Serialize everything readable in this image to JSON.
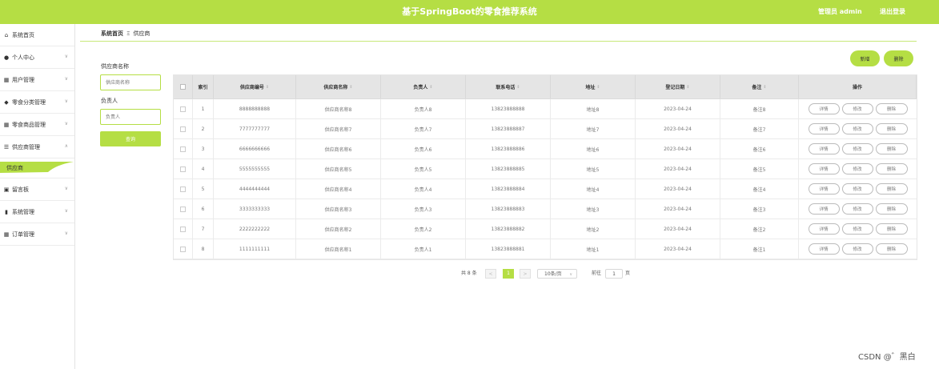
{
  "header": {
    "title": "基于SpringBoot的零食推荐系统",
    "admin": "管理员 admin",
    "logout": "退出登录"
  },
  "sidebar": {
    "items": [
      {
        "label": "系统首页",
        "icon": "home-icon",
        "glyph": "⌂"
      },
      {
        "label": "个人中心",
        "icon": "user-icon",
        "glyph": "●"
      },
      {
        "label": "用户管理",
        "icon": "grid-icon",
        "glyph": "▦"
      },
      {
        "label": "零食分类管理",
        "icon": "tag-icon",
        "glyph": "◆"
      },
      {
        "label": "零食商品管理",
        "icon": "grid-icon",
        "glyph": "▦"
      },
      {
        "label": "供应商管理",
        "icon": "list-icon",
        "glyph": "☰"
      },
      {
        "label": "留言板",
        "icon": "message-icon",
        "glyph": "▣"
      },
      {
        "label": "系统管理",
        "icon": "chart-icon",
        "glyph": "▮"
      },
      {
        "label": "订单管理",
        "icon": "grid-icon",
        "glyph": "▦"
      }
    ],
    "sub_item": "供应商",
    "accent": "#b5de44"
  },
  "breadcrumb": {
    "home": "系统首页",
    "separator": "Ξ",
    "current": "供应商"
  },
  "search": {
    "name_label": "供应商名称",
    "name_placeholder": "供应商名称",
    "person_label": "负责人",
    "person_placeholder": "负责人",
    "query_button": "查询"
  },
  "toolbar": {
    "add": "新增",
    "delete": "删除"
  },
  "table": {
    "headers": [
      "索引",
      "供应商编号",
      "供应商名称",
      "负责人",
      "联系电话",
      "地址",
      "登记日期",
      "备注",
      "操作"
    ],
    "rows": [
      {
        "index": "1",
        "code": "8888888888",
        "name": "供应商名称8",
        "person": "负责人8",
        "phone": "13823888888",
        "address": "地址8",
        "date": "2023-04-24",
        "note": "备注8"
      },
      {
        "index": "2",
        "code": "7777777777",
        "name": "供应商名称7",
        "person": "负责人7",
        "phone": "13823888887",
        "address": "地址7",
        "date": "2023-04-24",
        "note": "备注7"
      },
      {
        "index": "3",
        "code": "6666666666",
        "name": "供应商名称6",
        "person": "负责人6",
        "phone": "13823888886",
        "address": "地址6",
        "date": "2023-04-24",
        "note": "备注6"
      },
      {
        "index": "4",
        "code": "5555555555",
        "name": "供应商名称5",
        "person": "负责人5",
        "phone": "13823888885",
        "address": "地址5",
        "date": "2023-04-24",
        "note": "备注5"
      },
      {
        "index": "5",
        "code": "4444444444",
        "name": "供应商名称4",
        "person": "负责人4",
        "phone": "13823888884",
        "address": "地址4",
        "date": "2023-04-24",
        "note": "备注4"
      },
      {
        "index": "6",
        "code": "3333333333",
        "name": "供应商名称3",
        "person": "负责人3",
        "phone": "13823888883",
        "address": "地址3",
        "date": "2023-04-24",
        "note": "备注3"
      },
      {
        "index": "7",
        "code": "2222222222",
        "name": "供应商名称2",
        "person": "负责人2",
        "phone": "13823888882",
        "address": "地址2",
        "date": "2023-04-24",
        "note": "备注2"
      },
      {
        "index": "8",
        "code": "1111111111",
        "name": "供应商名称1",
        "person": "负责人1",
        "phone": "13823888881",
        "address": "地址1",
        "date": "2023-04-24",
        "note": "备注1"
      }
    ],
    "actions": [
      "详情",
      "修改",
      "删除"
    ]
  },
  "pagination": {
    "total": "共 8 条",
    "prev": "<",
    "page": "1",
    "next": ">",
    "page_size": "10条/页",
    "goto_label": "前往",
    "goto_value": "1",
    "goto_unit": "页"
  },
  "watermark": "CSDN @゛黑白"
}
